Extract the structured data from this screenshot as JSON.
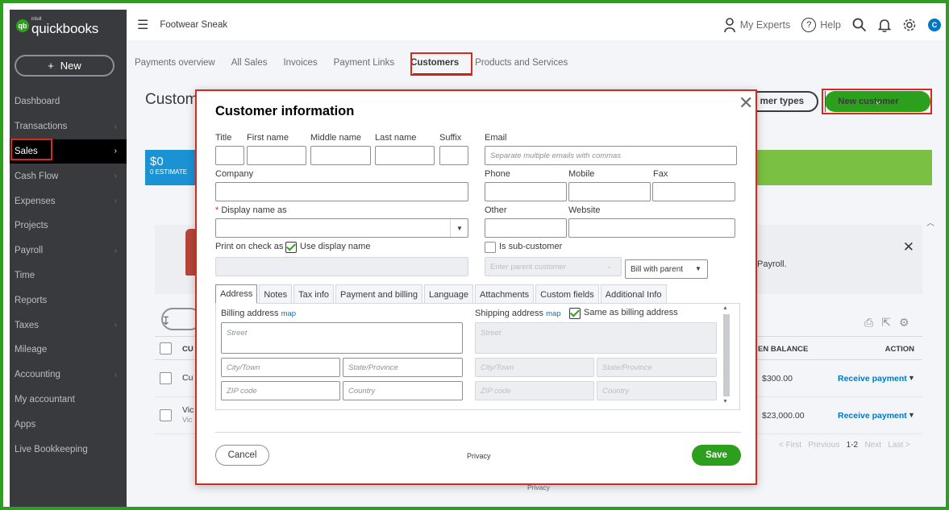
{
  "app": {
    "logo_small": "intuit",
    "logo_main": "quickbooks",
    "company": "Footwear Sneak"
  },
  "sidebar": {
    "new_label": "New",
    "items": [
      {
        "label": "Dashboard",
        "chevron": false
      },
      {
        "label": "Transactions",
        "chevron": true
      },
      {
        "label": "Sales",
        "chevron": true,
        "active": true
      },
      {
        "label": "Cash Flow",
        "chevron": true
      },
      {
        "label": "Expenses",
        "chevron": true
      },
      {
        "label": "Projects",
        "chevron": false
      },
      {
        "label": "Payroll",
        "chevron": true
      },
      {
        "label": "Time",
        "chevron": false
      },
      {
        "label": "Reports",
        "chevron": false
      },
      {
        "label": "Taxes",
        "chevron": true
      },
      {
        "label": "Mileage",
        "chevron": false
      },
      {
        "label": "Accounting",
        "chevron": true
      },
      {
        "label": "My accountant",
        "chevron": false
      },
      {
        "label": "Apps",
        "chevron": false
      },
      {
        "label": "Live Bookkeeping",
        "chevron": false
      }
    ]
  },
  "topbar": {
    "experts": "My Experts",
    "help": "Help",
    "avatar": "C"
  },
  "tabs": [
    "Payments overview",
    "All Sales",
    "Invoices",
    "Payment Links",
    "Customers",
    "Products and Services"
  ],
  "page": {
    "title": "Custom",
    "customer_types_btn": "mer types",
    "new_customer_btn": "New customer",
    "estimate_amount": "$0",
    "estimate_label": "0 ESTIMATE",
    "banner_text": "Payroll.",
    "table": {
      "head_cu": "CU",
      "head_balance": "EN BALANCE",
      "head_action": "ACTION",
      "rows": [
        {
          "name": "Cu",
          "balance": "$300.00",
          "action": "Receive payment"
        },
        {
          "name": "Vic",
          "sub": "Vic",
          "balance": "$23,000.00",
          "action": "Receive payment"
        }
      ]
    },
    "pager": {
      "first": "< First",
      "prev": "Previous",
      "range": "1-2",
      "next": "Next",
      "last": "Last >"
    },
    "privacy": "Privacy"
  },
  "modal": {
    "title": "Customer information",
    "labels": {
      "title": "Title",
      "first": "First name",
      "middle": "Middle name",
      "last": "Last name",
      "suffix": "Suffix",
      "email": "Email",
      "company": "Company",
      "phone": "Phone",
      "mobile": "Mobile",
      "fax": "Fax",
      "display": "Display name as",
      "other": "Other",
      "website": "Website",
      "print_on_check": "Print on check as",
      "use_display": "Use display name",
      "is_sub": "Is sub-customer",
      "bill_with_parent": "Bill with parent"
    },
    "placeholders": {
      "email": "Separate multiple emails with commas",
      "parent": "Enter parent customer",
      "street": "Street",
      "city": "City/Town",
      "state": "State/Province",
      "zip": "ZIP code",
      "country": "Country"
    },
    "tabs": [
      "Address",
      "Notes",
      "Tax info",
      "Payment and billing",
      "Language",
      "Attachments",
      "Custom fields",
      "Additional Info"
    ],
    "billing_label": "Billing address",
    "shipping_label": "Shipping address",
    "map": "map",
    "same_as_billing": "Same as billing address",
    "cancel": "Cancel",
    "privacy": "Privacy",
    "save": "Save"
  }
}
